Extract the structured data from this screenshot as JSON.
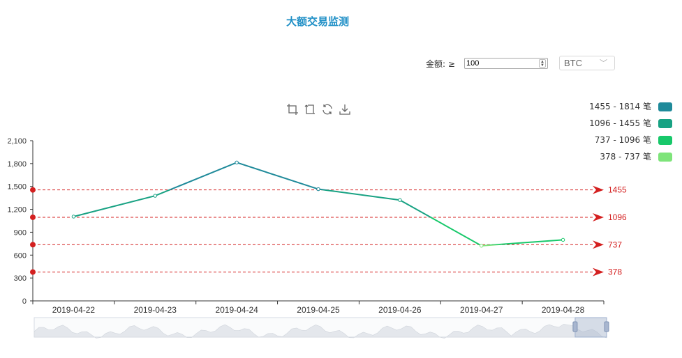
{
  "title": "大额交易监测",
  "filter": {
    "label": "金额: ≥",
    "amount_value": "100",
    "coin_selected": "BTC"
  },
  "toolbox": [
    {
      "name": "zoom-icon"
    },
    {
      "name": "zoom-back-icon"
    },
    {
      "name": "restore-icon"
    },
    {
      "name": "download-icon"
    }
  ],
  "legend": [
    {
      "label": "1455 - 1814 笔",
      "color": "#1f8a9a"
    },
    {
      "label": "1096 - 1455 笔",
      "color": "#18a283"
    },
    {
      "label": "737 - 1096 笔",
      "color": "#17c86a"
    },
    {
      "label": "378 - 737 笔",
      "color": "#7ee47a"
    }
  ],
  "chart_data": {
    "type": "line",
    "categories": [
      "2019-04-22",
      "2019-04-23",
      "2019-04-24",
      "2019-04-25",
      "2019-04-26",
      "2019-04-27",
      "2019-04-28"
    ],
    "values": [
      1105,
      1378,
      1814,
      1465,
      1322,
      723,
      800
    ],
    "ylim": [
      0,
      2100
    ],
    "yticks": [
      0,
      300,
      600,
      900,
      1200,
      1500,
      1800,
      2100
    ],
    "ytick_labels": [
      "0",
      "300",
      "600",
      "900",
      "1,200",
      "1,500",
      "1,800",
      "2,100"
    ],
    "mark_lines": [
      {
        "value": 1455,
        "label": "1455"
      },
      {
        "value": 1096,
        "label": "1096"
      },
      {
        "value": 737,
        "label": "737"
      },
      {
        "value": 378,
        "label": "378"
      }
    ],
    "mark_line_color": "#d42020",
    "piece_colors": [
      {
        "min": 1455,
        "max": 1814,
        "color": "#1f8a9a"
      },
      {
        "min": 1096,
        "max": 1455,
        "color": "#18a283"
      },
      {
        "min": 737,
        "max": 1096,
        "color": "#17c86a"
      },
      {
        "min": 378,
        "max": 737,
        "color": "#7ee47a"
      }
    ],
    "datazoom_range": [
      0.945,
      1.0
    ]
  }
}
